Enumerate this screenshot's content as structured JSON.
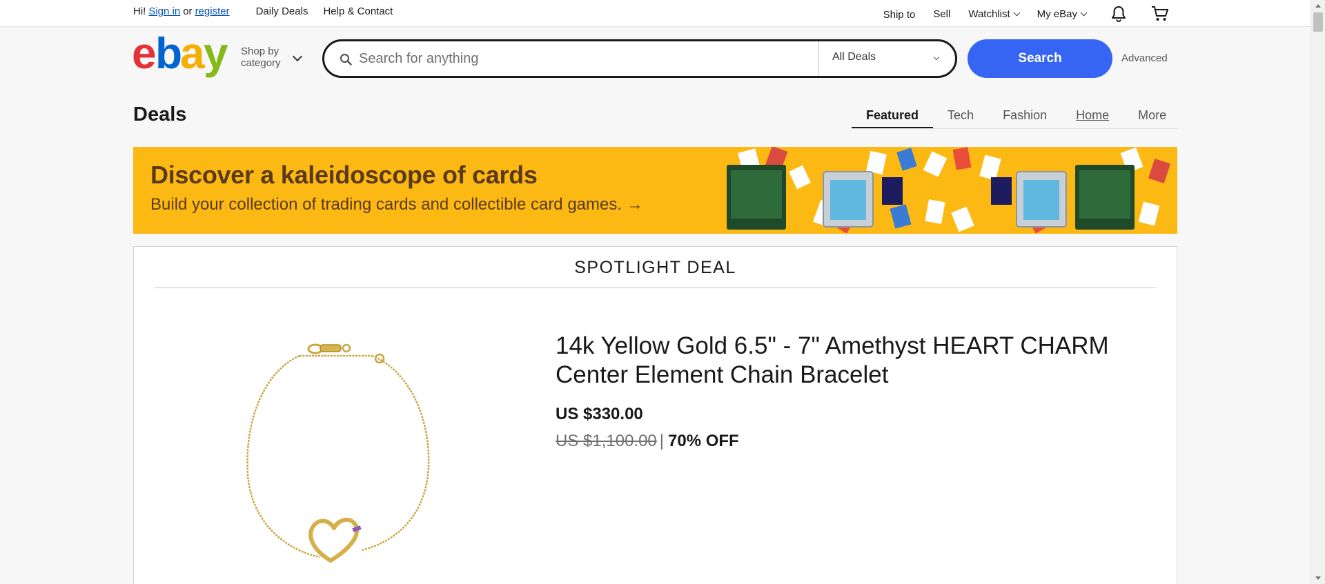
{
  "topbar": {
    "greeting": "Hi!",
    "sign_in": "Sign in",
    "or": "or",
    "register": "register",
    "daily_deals": "Daily Deals",
    "help_contact": "Help & Contact",
    "ship_to": "Ship to",
    "sell": "Sell",
    "watchlist": "Watchlist",
    "my_ebay": "My eBay"
  },
  "header": {
    "shop_by_line1": "Shop by",
    "shop_by_line2": "category",
    "search_placeholder": "Search for anything",
    "category_selected": "All Deals",
    "search_button": "Search",
    "advanced": "Advanced"
  },
  "deals": {
    "title": "Deals",
    "tabs": [
      {
        "label": "Featured"
      },
      {
        "label": "Tech"
      },
      {
        "label": "Fashion"
      },
      {
        "label": "Home"
      },
      {
        "label": "More"
      }
    ]
  },
  "banner": {
    "headline": "Discover a kaleidoscope of cards",
    "subline": "Build your collection of trading cards and collectible card games. →",
    "background": "#fdb913",
    "text_color": "#5b3a1c"
  },
  "spotlight": {
    "heading": "SPOTLIGHT DEAL",
    "product_title": "14k Yellow Gold 6.5\" - 7\" Amethyst HEART CHARM Center Element Chain Bracelet",
    "price": "US $330.00",
    "original_price": "US $1,100.00",
    "separator": "|",
    "discount": "70% OFF"
  },
  "colors": {
    "accent": "#3665f3",
    "link": "#0654ba"
  }
}
